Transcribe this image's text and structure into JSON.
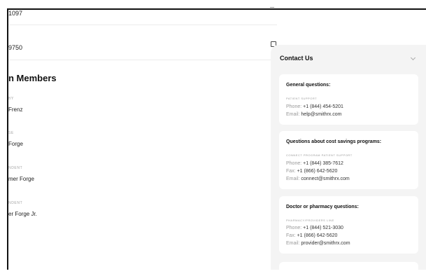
{
  "top_rows": [
    {
      "value": "1097"
    },
    {
      "value": "9750"
    }
  ],
  "members_section": {
    "title": "n Members",
    "members": [
      {
        "role": "BY",
        "name": "Frenz"
      },
      {
        "role": "SE",
        "name": "Forge"
      },
      {
        "role": "NDENT",
        "name": "mer Forge"
      },
      {
        "role": "NDENT",
        "name": "er Forge Jr."
      }
    ]
  },
  "contact": {
    "title": "Contact Us",
    "cards": [
      {
        "title": "General questions:",
        "subtitle": "PATIENT SUPPORT",
        "lines": [
          {
            "label": "Phone:",
            "value": "+1 (844) 454-5201"
          },
          {
            "label": "Email:",
            "value": "help@smithrx.com"
          }
        ]
      },
      {
        "title": "Questions about cost savings programs:",
        "subtitle": "CONNECT PROGRAM PATIENT SUPPORT",
        "lines": [
          {
            "label": "Phone:",
            "value": "+1 (844) 385-7612"
          },
          {
            "label": "Fax:",
            "value": "+1 (866) 642-5620"
          },
          {
            "label": "Email:",
            "value": "connect@smithrx.com"
          }
        ]
      },
      {
        "title": "Doctor or pharmacy questions:",
        "subtitle": "PHARMACY/PROVIDERS LINE",
        "lines": [
          {
            "label": "Phone:",
            "value": "+1 (844) 521-3030"
          },
          {
            "label": "Fax:",
            "value": "+1 (866) 642-5620"
          },
          {
            "label": "Email:",
            "value": "provider@smithrx.com"
          }
        ]
      }
    ]
  },
  "icons": {
    "copy": "copy-icon",
    "chevron": "chevron-down-icon",
    "dash": "minus-icon"
  }
}
